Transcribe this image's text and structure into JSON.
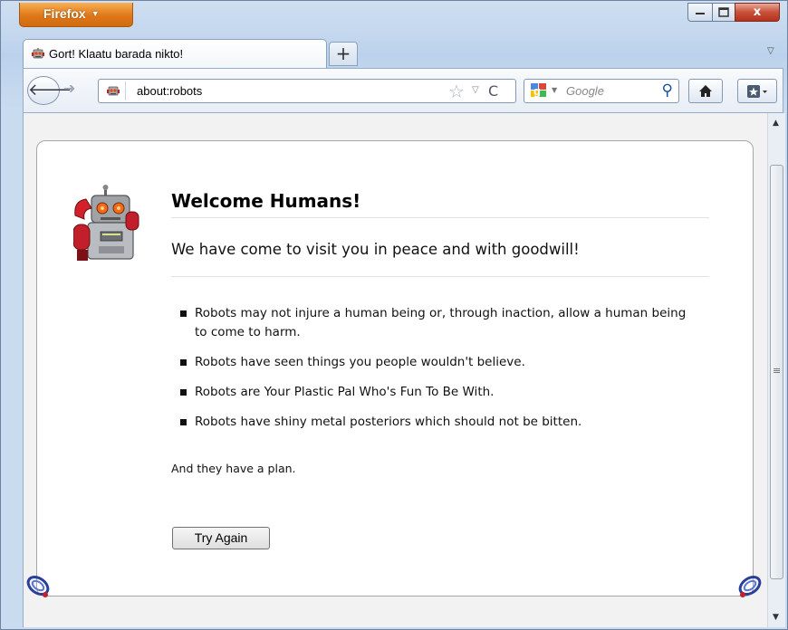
{
  "browser": {
    "menu_button": "Firefox",
    "window_controls": {
      "close": "x"
    }
  },
  "tabs": [
    {
      "label": "Gort! Klaatu barada nikto!"
    }
  ],
  "new_tab_label": "+",
  "nav": {
    "url": "about:robots",
    "search_placeholder": "Google"
  },
  "page": {
    "title": "Welcome Humans!",
    "subtitle": "We have come to visit you in peace and with goodwill!",
    "laws": [
      "Robots may not injure a human being or, through inaction, allow a human being to come to harm.",
      "Robots have seen things you people wouldn't believe.",
      "Robots are Your Plastic Pal Who's Fun To Be With.",
      "Robots have shiny metal posteriors which should not be bitten."
    ],
    "plan_text": "And they have a plan.",
    "try_again_label": "Try Again"
  },
  "colors": {
    "firefox_button": "#e0781a",
    "close_button": "#c7503a",
    "window_frame": "#bcd2ec",
    "content_bg": "#f2f2f2"
  }
}
